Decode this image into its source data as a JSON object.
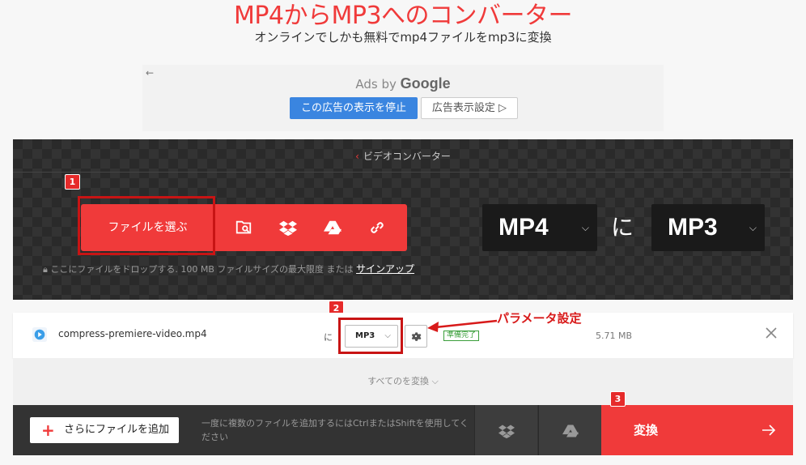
{
  "header": {
    "title": "MP4からMP3へのコンバーター",
    "subtitle": "オンラインでしかも無料でmp4ファイルをmp3に変換"
  },
  "ad": {
    "ads_by": "Ads by",
    "google": "Google",
    "stop_label": "この広告の表示を停止",
    "settings_label": "広告表示設定 ▷"
  },
  "hero": {
    "breadcrumb": "ビデオコンバーター",
    "choose_file": "ファイルを選ぶ",
    "drop_hint": "ここにファイルをドロップする. 100 MB ファイルサイズの最大限度 または",
    "signup": "サインアップ",
    "from_format": "MP4",
    "to_word": "に",
    "to_format": "MP3"
  },
  "badges": {
    "one": "1",
    "two": "2",
    "three": "3"
  },
  "file": {
    "name": "compress-premiere-video.mp4",
    "to_word": "に",
    "format": "MP3",
    "status": "準備完了",
    "size": "5.71 MB"
  },
  "annotation": {
    "param_label": "パラメータ設定"
  },
  "convert_all": "すべてのを変換 ⌵",
  "bottom": {
    "add_more": "さらにファイルを追加",
    "hint": "一度に複数のファイルを追加するにはCtrlまたはShiftを使用してください",
    "convert": "変換"
  },
  "colors": {
    "accent": "#f03a3a",
    "highlight": "#c81414",
    "dark": "#2a2a2a",
    "ad_blue": "#3a85e0"
  }
}
